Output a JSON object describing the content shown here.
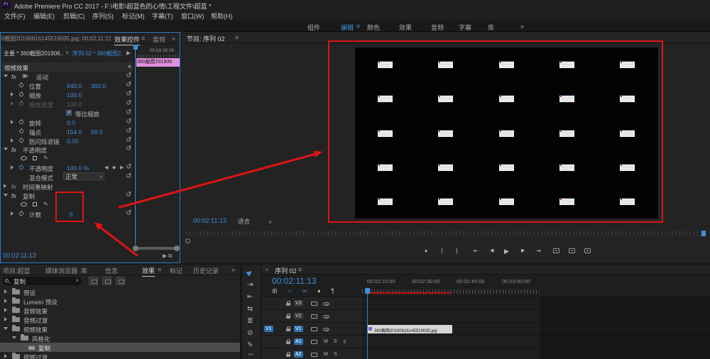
{
  "title_bar": {
    "title": "Adobe Premiere Pro CC 2017 - F:\\电影\\超蓝色的心情\\工程文件\\超蓝 *",
    "logo": "Pr"
  },
  "menu": {
    "items": [
      "文件(F)",
      "编辑(E)",
      "剪辑(C)",
      "序列(S)",
      "标记(M)",
      "字幕(T)",
      "窗口(W)",
      "帮助(H)"
    ]
  },
  "workspaces": {
    "items": [
      "组件",
      "编辑",
      "颜色",
      "效果",
      "音频",
      "字幕",
      "库",
      "»"
    ],
    "active": "编辑"
  },
  "effect_controls": {
    "tab_source": "0截图20190616145519035.jpg: 00:02:11:13",
    "tab_label": "效果控件",
    "tab_audio": "音频",
    "overflow": "»",
    "master_clip": "主要 * 360截图201906...",
    "sequence_clip": "序列 02 * 360截图2...",
    "ruler_label": "00:02:30:00",
    "mini_clip_label": "360截图201906",
    "section_video": "视频效果",
    "rows": [
      {
        "label": "运动"
      },
      {
        "label": "位置",
        "v1": "640.0",
        "v2": "360.0"
      },
      {
        "label": "缩放",
        "v1": "100.0"
      },
      {
        "label": "缩放宽度",
        "v1": "100.0"
      },
      {
        "label": "等比缩放"
      },
      {
        "label": "旋转",
        "v1": "0.0"
      },
      {
        "label": "锚点",
        "v1": "154.0",
        "v2": "59.0"
      },
      {
        "label": "防闪烁滤镜",
        "v1": "0.00"
      },
      {
        "label": "不透明度"
      },
      {
        "label": "不透明度",
        "v1": "100.0 %"
      },
      {
        "label": "混合模式",
        "v1": "正常"
      },
      {
        "label": "时间重映射"
      },
      {
        "label": "复制"
      },
      {
        "label": "计数",
        "v1": "5"
      }
    ],
    "fx": "fx",
    "timecode": "00:02:11:13"
  },
  "program": {
    "tab_label": "节目: 序列 02",
    "timecode": "00:02:11:13",
    "zoom_level": "适合",
    "accent_red": "#dd1414"
  },
  "effects_panel": {
    "tabs": [
      "项目:超蓝",
      "媒体浏览器",
      "库",
      "信息",
      "效果",
      "标记",
      "历史记录",
      "»"
    ],
    "active_tab": "效果",
    "search_value": "复制",
    "tree": [
      {
        "label": "预设"
      },
      {
        "label": "Lumetri 预设"
      },
      {
        "label": "音频效果"
      },
      {
        "label": "音频过渡"
      },
      {
        "label": "视频效果"
      },
      {
        "label": "风格化"
      },
      {
        "label": "复制"
      },
      {
        "label": "视频过渡"
      }
    ]
  },
  "timeline": {
    "tab_label": "序列 02",
    "timecode": "00:02:11:13",
    "ruler": [
      "00:02:15:00",
      "00:02:30:00",
      "00:02:45:00",
      "00:03:00:00"
    ],
    "tracks": {
      "v3": "V3",
      "v2": "V2",
      "v1": "V1",
      "a1": "A1",
      "a2": "A2"
    },
    "source_patch_v1": "V1",
    "mute": "M",
    "solo": "S",
    "clip_name": "360截图20190616145519035.jpg"
  }
}
